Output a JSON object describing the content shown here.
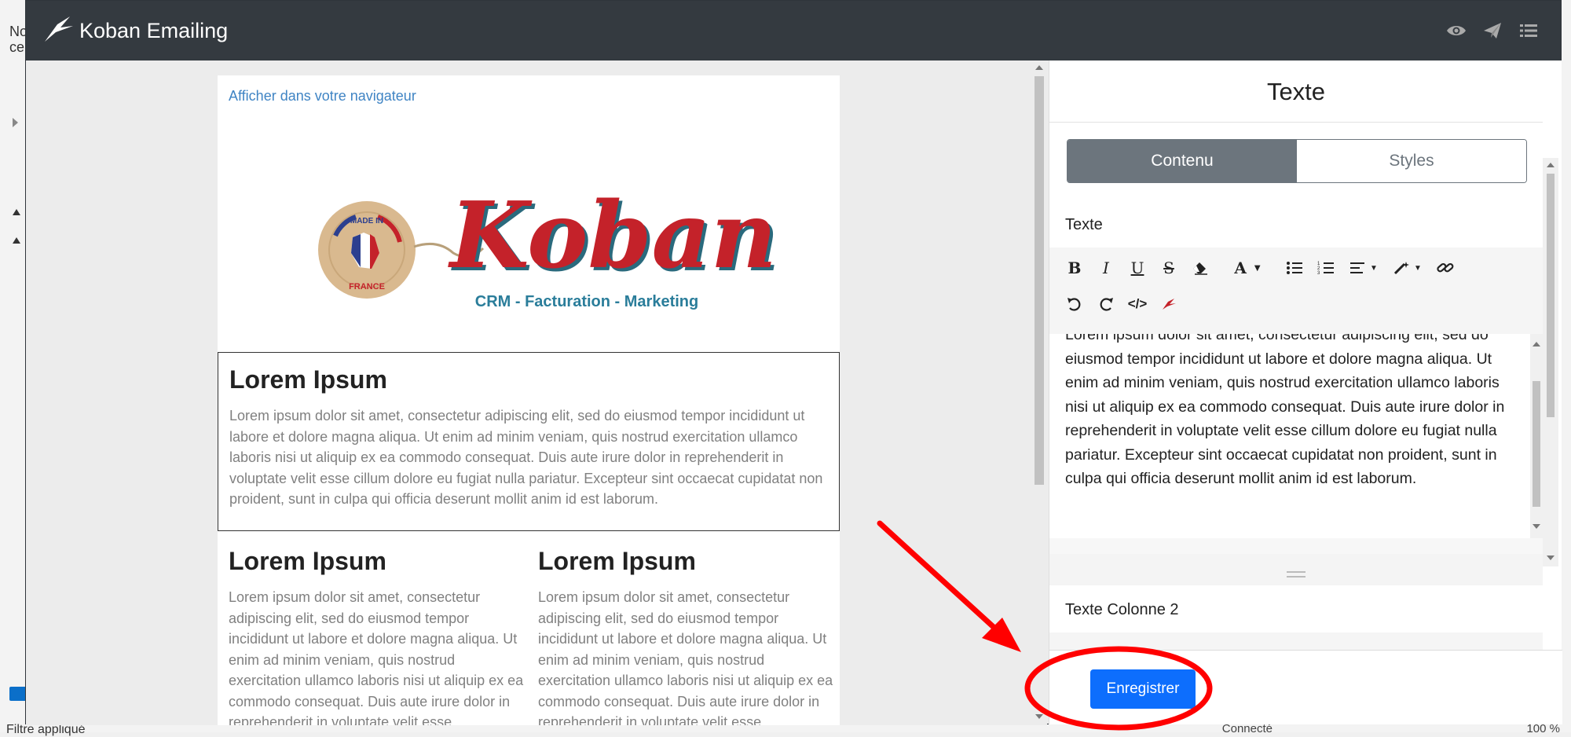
{
  "background": {
    "edge_texts": [
      "No",
      "ce"
    ],
    "bottom_left_text": "Filtre appliqué",
    "status_text": "Connecté",
    "zoom_text": "100 %"
  },
  "app": {
    "title": "Koban Emailing",
    "icons": [
      "eye-icon",
      "send-icon",
      "menu-icon"
    ]
  },
  "preview": {
    "view_in_browser": "Afficher dans votre navigateur",
    "logo": {
      "badge_top": "MADE IN",
      "badge_bottom": "FRANCE",
      "brand": "Koban",
      "tagline": "CRM - Facturation - Marketing"
    },
    "block1": {
      "title": "Lorem Ipsum",
      "body": "Lorem ipsum dolor sit amet, consectetur adipiscing elit, sed do eiusmod tempor incididunt ut labore et dolore magna aliqua. Ut enim ad minim veniam, quis nostrud exercitation ullamco laboris nisi ut aliquip ex ea commodo consequat. Duis aute irure dolor in reprehenderit in voluptate velit esse cillum dolore eu fugiat nulla pariatur. Excepteur sint occaecat cupidatat non proident, sunt in culpa qui officia deserunt mollit anim id est laborum."
    },
    "col1": {
      "title": "Lorem Ipsum",
      "body": "Lorem ipsum dolor sit amet, consectetur adipiscing elit, sed do eiusmod tempor incididunt ut labore et dolore magna aliqua. Ut enim ad minim veniam, quis nostrud exercitation ullamco laboris nisi ut aliquip ex ea commodo consequat. Duis aute irure dolor in reprehenderit in voluptate velit esse"
    },
    "col2": {
      "title": "Lorem Ipsum",
      "body": "Lorem ipsum dolor sit amet, consectetur adipiscing elit, sed do eiusmod tempor incididunt ut labore et dolore magna aliqua. Ut enim ad minim veniam, quis nostrud exercitation ullamco laboris nisi ut aliquip ex ea commodo consequat. Duis aute irure dolor in reprehenderit in voluptate velit esse"
    }
  },
  "panel": {
    "title": "Texte",
    "tabs": [
      {
        "label": "Contenu",
        "active": true
      },
      {
        "label": "Styles",
        "active": false
      }
    ],
    "field1_label": "Texte",
    "editor_text": "Lorem ipsum dolor sit amet, consectetur adipiscing elit, sed do eiusmod tempor incididunt ut labore et dolore magna aliqua. Ut enim ad minim veniam, quis nostrud exercitation ullamco laboris nisi ut aliquip ex ea commodo consequat. Duis aute irure dolor in reprehenderit in voluptate velit esse cillum dolore eu fugiat nulla pariatur. Excepteur sint occaecat cupidatat non proident, sunt in culpa qui officia deserunt mollit anim id est laborum.",
    "field2_label": "Texte Colonne 2",
    "toolbar_icons": [
      "bold-icon",
      "italic-icon",
      "underline-icon",
      "strikethrough-icon",
      "eraser-icon",
      "font-color-icon",
      "bullet-list-icon",
      "numbered-list-icon",
      "align-icon",
      "magic-wand-icon",
      "link-icon",
      "undo-icon",
      "redo-icon",
      "code-icon",
      "koban-icon"
    ],
    "save_label": "Enregistrer"
  },
  "annotation": {
    "color": "#ff0000"
  }
}
